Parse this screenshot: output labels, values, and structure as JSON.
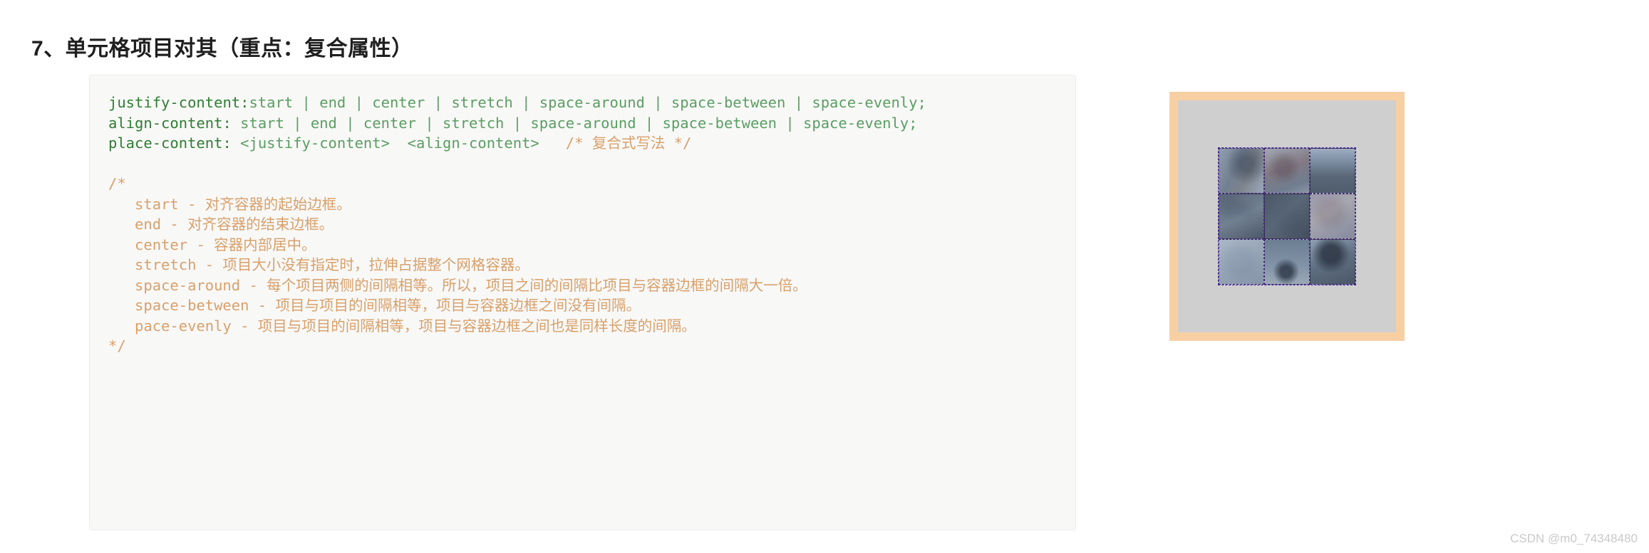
{
  "page": {
    "title": "7、单元格项目对其（重点：复合属性）",
    "watermark": "CSDN @m0_74348480",
    "background_color": "#ffffff"
  },
  "code_block": {
    "background_color": "#f8f8f7",
    "border_color": "#ececec",
    "language": "css",
    "colors": {
      "property": "#2e7d32",
      "value": "#5a9e62",
      "comment": "#d9a06a",
      "chinese_comment": "#c78a5c"
    },
    "lines": [
      {
        "id": "line-1",
        "segments": [
          {
            "text": "justify-content:",
            "type": "property"
          },
          {
            "text": "start | end | center | stretch | space-around | space-between | space-evenly;",
            "type": "value"
          }
        ],
        "plain": "justify-content:start | end | center | stretch | space-around | space-between | space-evenly;"
      },
      {
        "id": "line-2",
        "segments": [
          {
            "text": "align-content: ",
            "type": "property"
          },
          {
            "text": "start | end | center | stretch | space-around | space-between | space-evenly;",
            "type": "value"
          }
        ],
        "plain": "align-content: start | end | center | stretch | space-around | space-between | space-evenly;"
      },
      {
        "id": "line-3",
        "segments": [
          {
            "text": "place-content: ",
            "type": "property"
          },
          {
            "text": "<justify-content>  <align-content>",
            "type": "value"
          },
          {
            "text": "   /* 复合式写法 */",
            "type": "comment"
          }
        ],
        "plain": "place-content:  <justify-content>  <align-content>    /* 复合式写法 */"
      },
      {
        "id": "line-4",
        "segments": [],
        "plain": ""
      },
      {
        "id": "line-5",
        "segments": [
          {
            "text": "/*",
            "type": "comment"
          }
        ],
        "plain": "/*"
      },
      {
        "id": "line-6",
        "indent": true,
        "segments": [
          {
            "text": "start - 对齐容器的起始边框。",
            "type": "comment"
          }
        ],
        "plain": "start - 对齐容器的起始边框。"
      },
      {
        "id": "line-7",
        "indent": true,
        "segments": [
          {
            "text": "end - 对齐容器的结束边框。",
            "type": "comment"
          }
        ],
        "plain": "end - 对齐容器的结束边框。"
      },
      {
        "id": "line-8",
        "indent": true,
        "segments": [
          {
            "text": "center - 容器内部居中。",
            "type": "comment"
          }
        ],
        "plain": "center - 容器内部居中。"
      },
      {
        "id": "line-9",
        "indent": true,
        "segments": [
          {
            "text": "stretch - 项目大小没有指定时，拉伸占据整个网格容器。",
            "type": "comment"
          }
        ],
        "plain": "stretch - 项目大小没有指定时，拉伸占据整个网格容器。"
      },
      {
        "id": "line-10",
        "indent": true,
        "segments": [
          {
            "text": "space-around - 每个项目两侧的间隔相等。所以，项目之间的间隔比项目与容器边框的间隔大一倍。",
            "type": "comment"
          }
        ],
        "plain": "space-around - 每个项目两侧的间隔相等。所以，项目之间的间隔比项目与容器边框的间隔大一倍。"
      },
      {
        "id": "line-11",
        "indent": true,
        "segments": [
          {
            "text": "space-between - 项目与项目的间隔相等，项目与容器边框之间没有间隔。",
            "type": "comment"
          }
        ],
        "plain": "space-between - 项目与项目的间隔相等，项目与容器边框之间没有间隔。"
      },
      {
        "id": "line-12",
        "indent": true,
        "segments": [
          {
            "text": "pace-evenly - 项目与项目的间隔相等，项目与容器边框之间也是同样长度的间隔。",
            "type": "comment"
          }
        ],
        "plain": "pace-evenly - 项目与项目的间隔相等，项目与容器边框之间也是同样长度的间隔。"
      },
      {
        "id": "line-13",
        "segments": [
          {
            "text": "*/",
            "type": "comment"
          }
        ],
        "plain": "*/"
      }
    ]
  },
  "demo": {
    "outer_border_color": "#f8cfa3",
    "container_color": "#cfcfcf",
    "grid_line_color": "#4a23a8",
    "grid_rows": 3,
    "grid_columns": 3,
    "alignment": "center (justify-content: center; align-content: center)",
    "cells": [
      {
        "id": "cell-1",
        "row": 1,
        "col": 1
      },
      {
        "id": "cell-2",
        "row": 1,
        "col": 2
      },
      {
        "id": "cell-3",
        "row": 1,
        "col": 3
      },
      {
        "id": "cell-4",
        "row": 2,
        "col": 1
      },
      {
        "id": "cell-5",
        "row": 2,
        "col": 2
      },
      {
        "id": "cell-6",
        "row": 2,
        "col": 3
      },
      {
        "id": "cell-7",
        "row": 3,
        "col": 1
      },
      {
        "id": "cell-8",
        "row": 3,
        "col": 2
      },
      {
        "id": "cell-9",
        "row": 3,
        "col": 3
      }
    ]
  }
}
